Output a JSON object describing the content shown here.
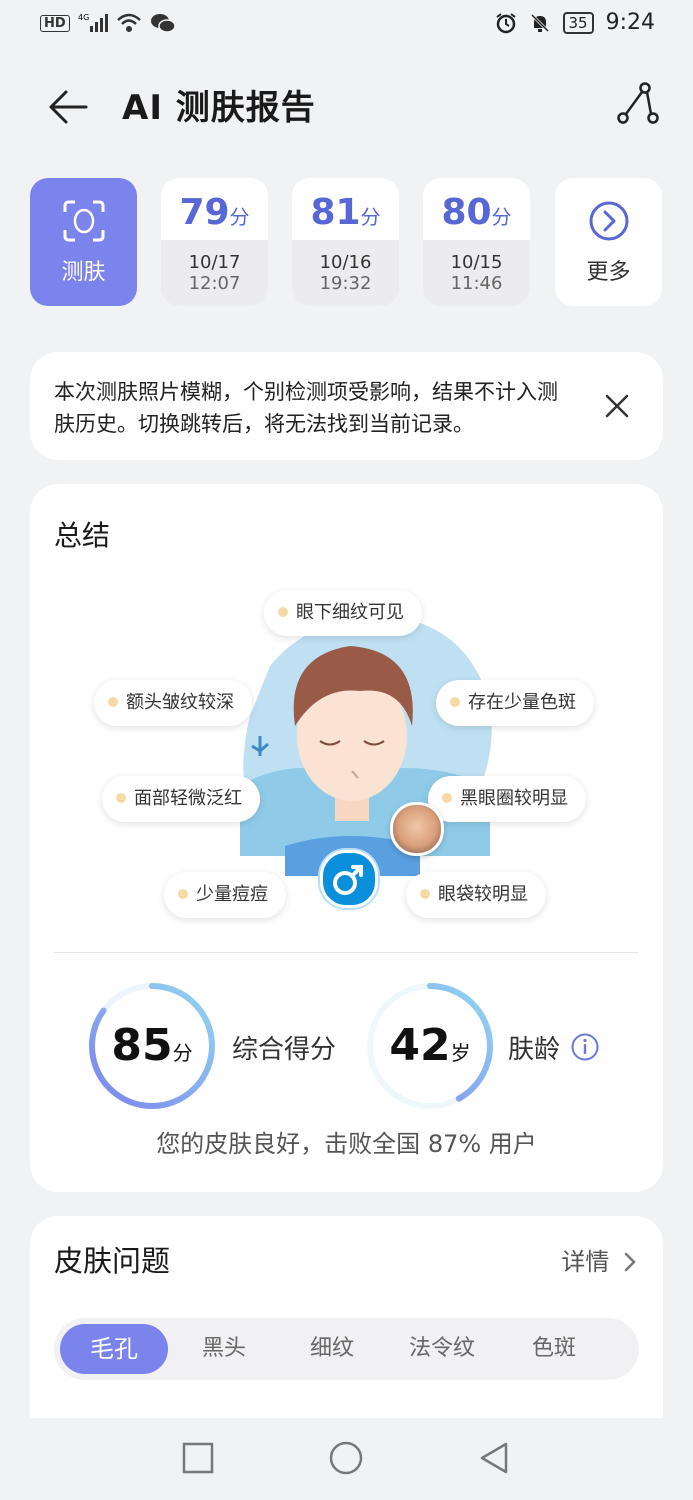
{
  "status_bar": {
    "left": "HD 4G",
    "battery": "35",
    "time": "9:24"
  },
  "header": {
    "title": "AI 测肤报告"
  },
  "tabs": [
    {
      "label": "测肤",
      "active": true
    },
    {
      "score": "79",
      "unit": "分",
      "date": "10/17",
      "time": "12:07"
    },
    {
      "score": "81",
      "unit": "分",
      "date": "10/16",
      "time": "19:32"
    },
    {
      "score": "80",
      "unit": "分",
      "date": "10/15",
      "time": "11:46"
    },
    {
      "label": "更多"
    }
  ],
  "notice": {
    "text": "本次测肤照片模糊，个别检测项受影响，结果不计入测肤历史。切换跳转后，将无法找到当前记录。"
  },
  "summary": {
    "title": "总结",
    "tags": [
      "眼下细纹可见",
      "额头皱纹较深",
      "存在少量色斑",
      "面部轻微泛红",
      "黑眼圈较明显",
      "少量痘痘",
      "眼袋较明显"
    ],
    "score": {
      "value": "85",
      "unit": "分",
      "label": "综合得分",
      "progress": 0.85
    },
    "age": {
      "value": "42",
      "unit": "岁",
      "label": "肤龄",
      "progress": 0.42
    },
    "line": "您的皮肤良好，击败全国 87% 用户"
  },
  "issues": {
    "title": "皮肤问题",
    "detail": "详情",
    "tabs": [
      "毛孔",
      "黑头",
      "细纹",
      "法令纹",
      "色斑"
    ]
  },
  "colors": {
    "accent": "#7b83ec",
    "score_blue": "#5867d6",
    "gender_blue": "#0a8fdc"
  }
}
